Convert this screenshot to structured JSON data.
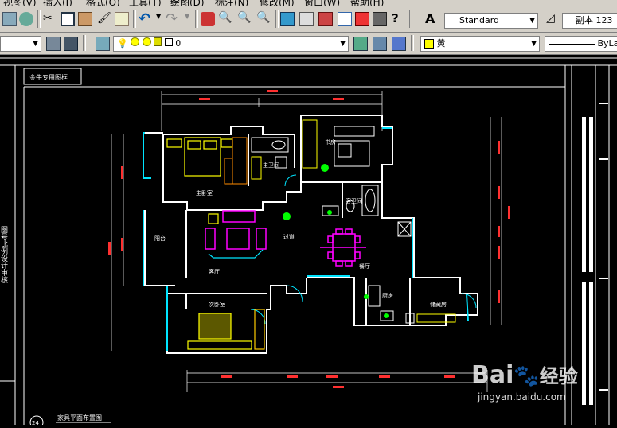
{
  "menu": [
    "视图(V)",
    "插入(I)",
    "格式(O)",
    "工具(T)",
    "绘图(D)",
    "标注(N)",
    "修改(M)",
    "窗口(W)",
    "帮助(H)"
  ],
  "toolbar": {
    "text_style": "Standard",
    "dim_style": "副本 123",
    "layer_name": "0",
    "color_name": "黄",
    "linetype_name": "ByLa"
  },
  "drawing": {
    "frame_title": "金牛专用图框",
    "sheet_label": "家具平面布置图",
    "sheet_number": "24",
    "rooms": {
      "master_bedroom": "主卧室",
      "study": "书房",
      "master_bath": "主卫间",
      "guest_bath": "客卫间",
      "balcony": "阳台",
      "living_room": "客厅",
      "corridor": "过道",
      "dining": "餐厅",
      "kitchen": "厨房",
      "second_bedroom": "次卧室",
      "storage": "储藏房"
    },
    "vertical_text": "图号比例设计审核"
  },
  "watermark": {
    "brand": "Bai",
    "brand2": "经验",
    "url": "jingyan.baidu.com"
  },
  "colors": {
    "wall": "#ffffff",
    "window": "#00e5ff",
    "furniture_yellow": "#ffff00",
    "furniture_magenta": "#ff00ff",
    "dimension": "#ff3030",
    "green": "#00ff00"
  }
}
